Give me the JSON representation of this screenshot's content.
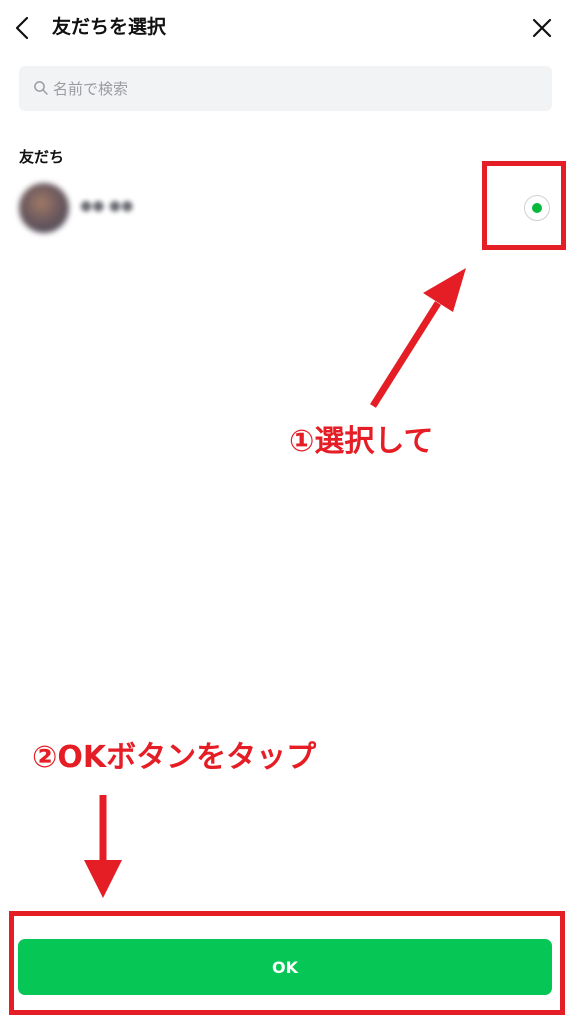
{
  "header": {
    "title": "友だちを選択",
    "back_icon": "chevron-left-icon",
    "close_icon": "close-icon"
  },
  "search": {
    "placeholder": "名前で検索",
    "icon": "search-icon"
  },
  "friends": {
    "section_label": "友だち",
    "items": [
      {
        "name": "●● ●●",
        "selected": true
      }
    ]
  },
  "annotations": {
    "step1": "①選択して",
    "step2": "②OKボタンをタップ",
    "color": "#e51e25"
  },
  "footer": {
    "ok_label": "OK",
    "ok_color": "#06c755"
  }
}
